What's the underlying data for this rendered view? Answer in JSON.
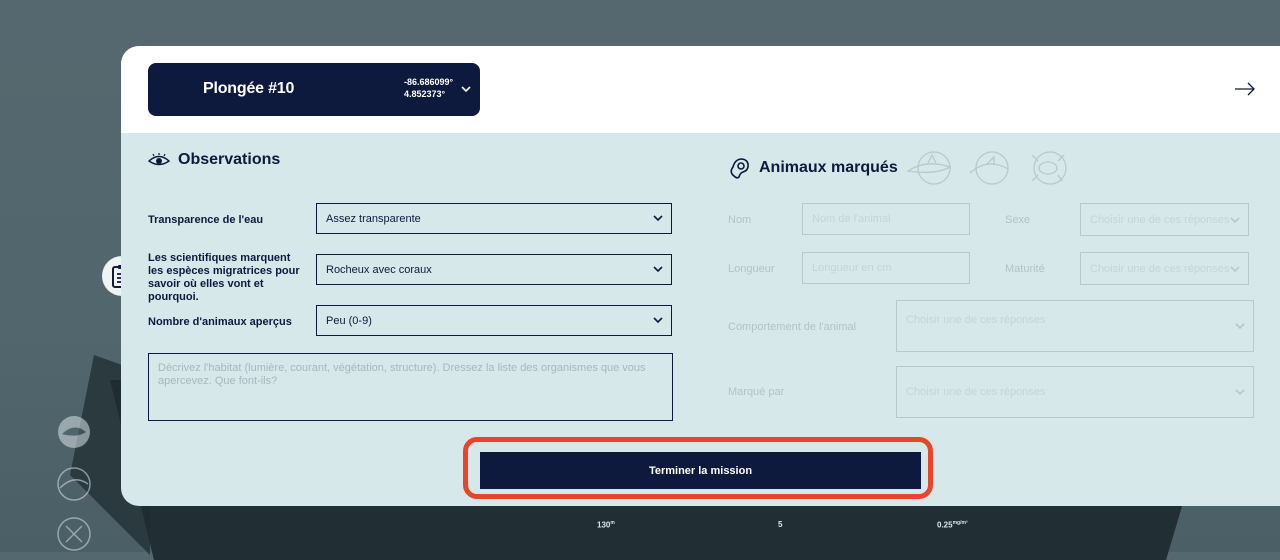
{
  "dive": {
    "title": "Plongée #10",
    "longitude": "-86.686099°",
    "latitude": "4.852373°"
  },
  "observations": {
    "heading": "Observations",
    "fields": [
      {
        "label": "Transparence de l'eau",
        "value": "Assez transparente"
      },
      {
        "label": "Les scientifiques marquent les espèces migratrices pour savoir où elles vont et pourquoi.",
        "value": "Rocheux avec coraux"
      },
      {
        "label": "Nombre d'animaux aperçus",
        "value": "Peu (0-9)"
      }
    ],
    "habitat_placeholder": "Décrivez l'habitat (lumière, courant, végétation, structure). Dressez la liste des organismes que vous apercevez. Que font-ils?"
  },
  "tagged": {
    "heading": "Animaux marqués",
    "name_label": "Nom",
    "name_placeholder": "Nom de l'animal",
    "sex_label": "Sexe",
    "sex_placeholder": "Choisir une de ces réponses",
    "length_label": "Longueur",
    "length_placeholder": "Longueur en cm",
    "maturity_label": "Maturité",
    "maturity_placeholder": "Choisir une de ces réponses",
    "behavior_label": "Comportement de l'animal",
    "behavior_placeholder": "Choisir une de ces réponses",
    "tagged_by_label": "Marqué par",
    "tagged_by_placeholder": "Choisir une de ces réponses"
  },
  "finish_label": "Terminer la mission",
  "stats": {
    "depth": "130",
    "depth_unit": "m",
    "count": "5",
    "concentration": "0.25",
    "concentration_unit": "mg/m³"
  },
  "colors": {
    "navy": "#0e1a3d",
    "panel": "#d6e8ea",
    "highlight": "#e8452c"
  }
}
